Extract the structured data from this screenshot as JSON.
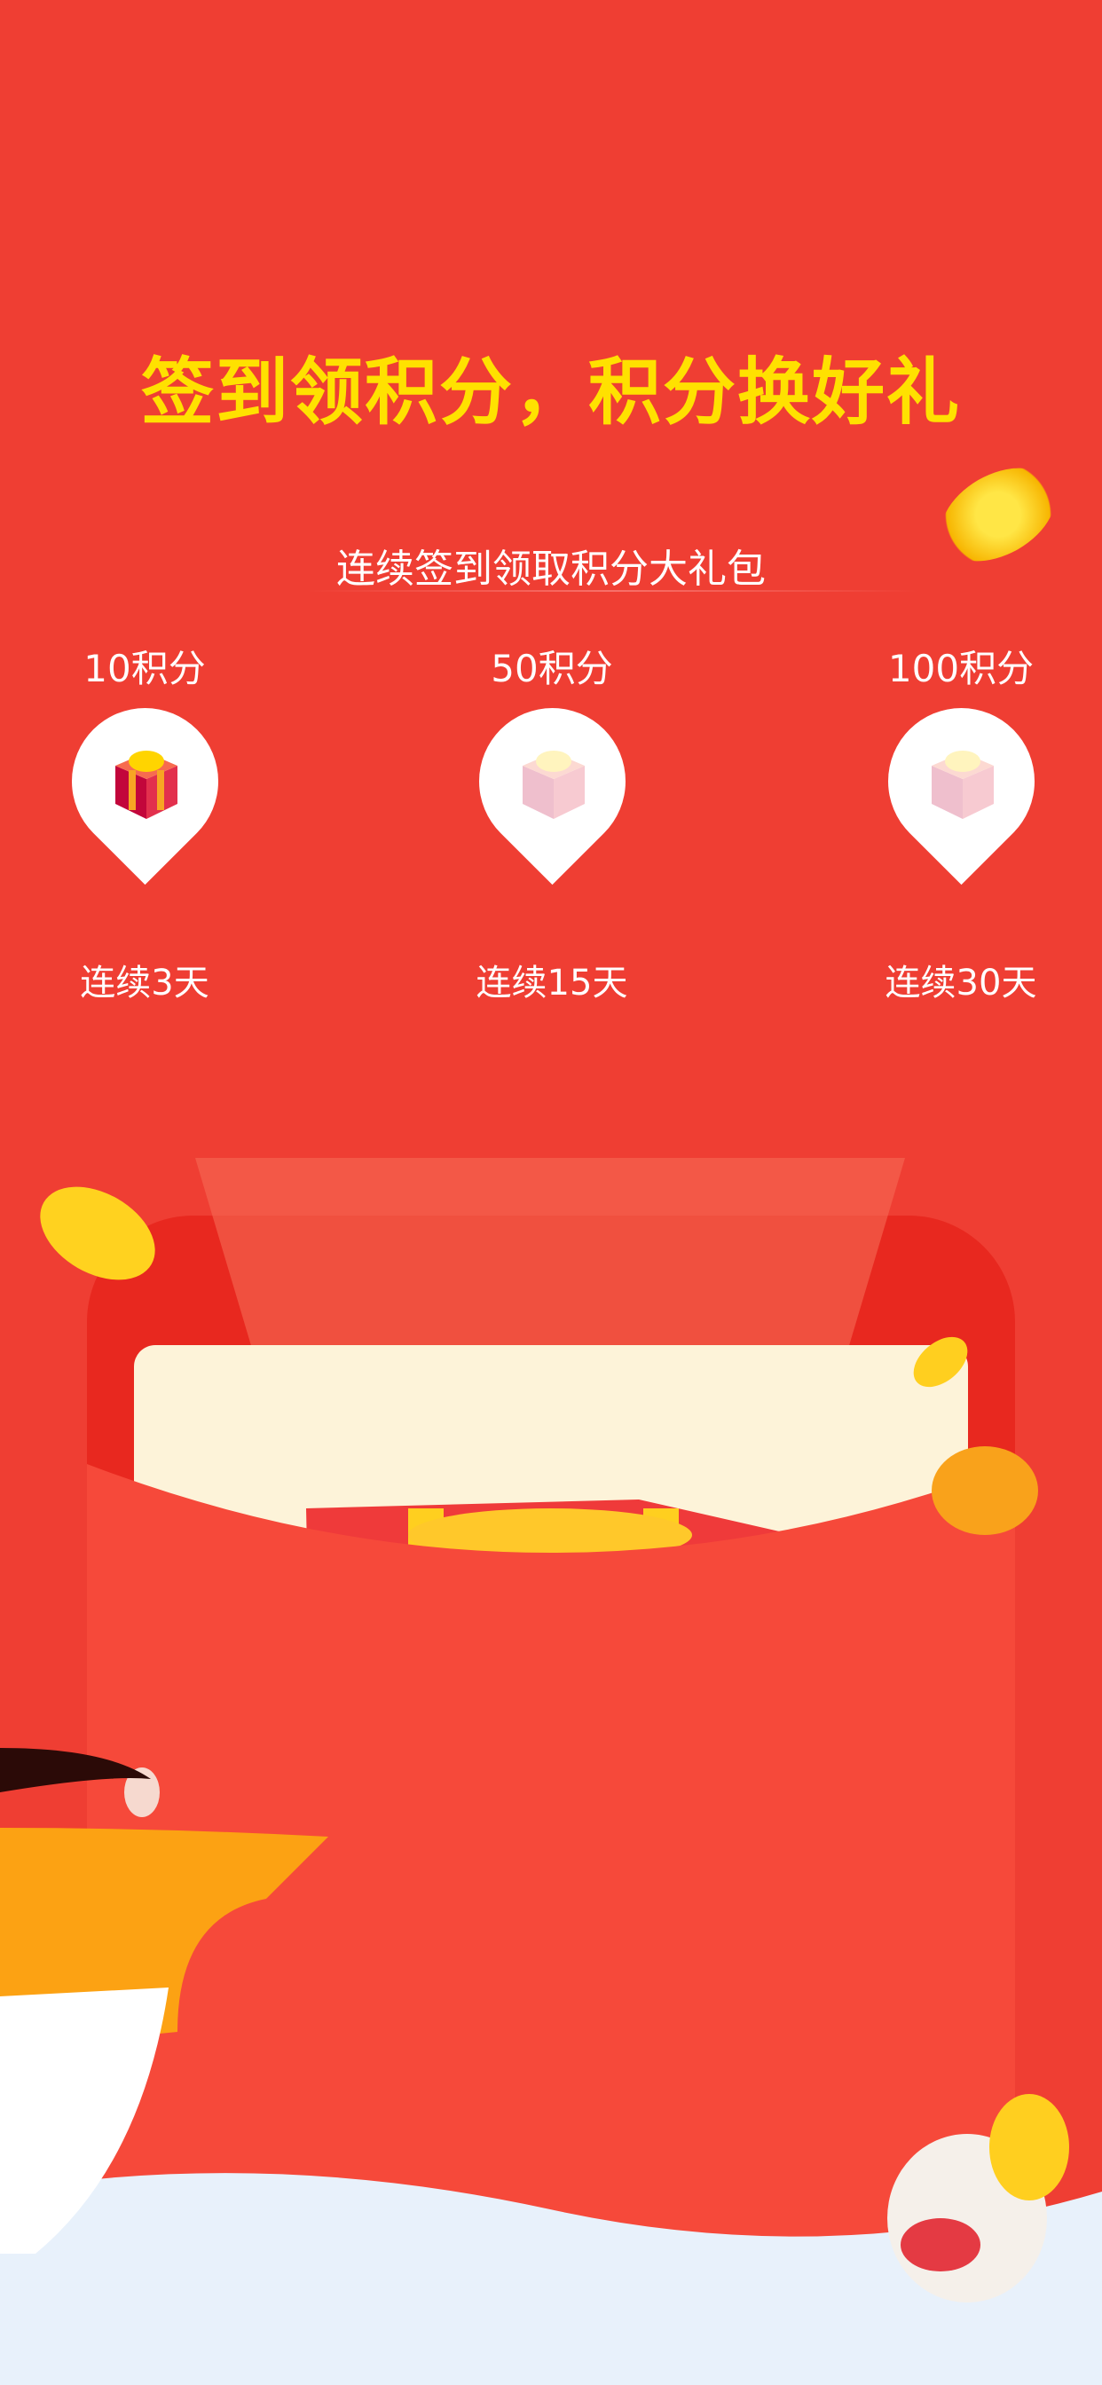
{
  "headline": "签到领积分，积分换好礼",
  "subtitle": "连续签到领取积分大礼包",
  "tiers": [
    {
      "points": "10积分",
      "days": "连续3天",
      "active": true
    },
    {
      "points": "50积分",
      "days": "连续15天",
      "active": false
    },
    {
      "points": "100积分",
      "days": "连续30天",
      "active": false
    }
  ],
  "colors": {
    "background": "#ef3e33",
    "headline": "#ffe100",
    "envelope": "#f6493a"
  }
}
